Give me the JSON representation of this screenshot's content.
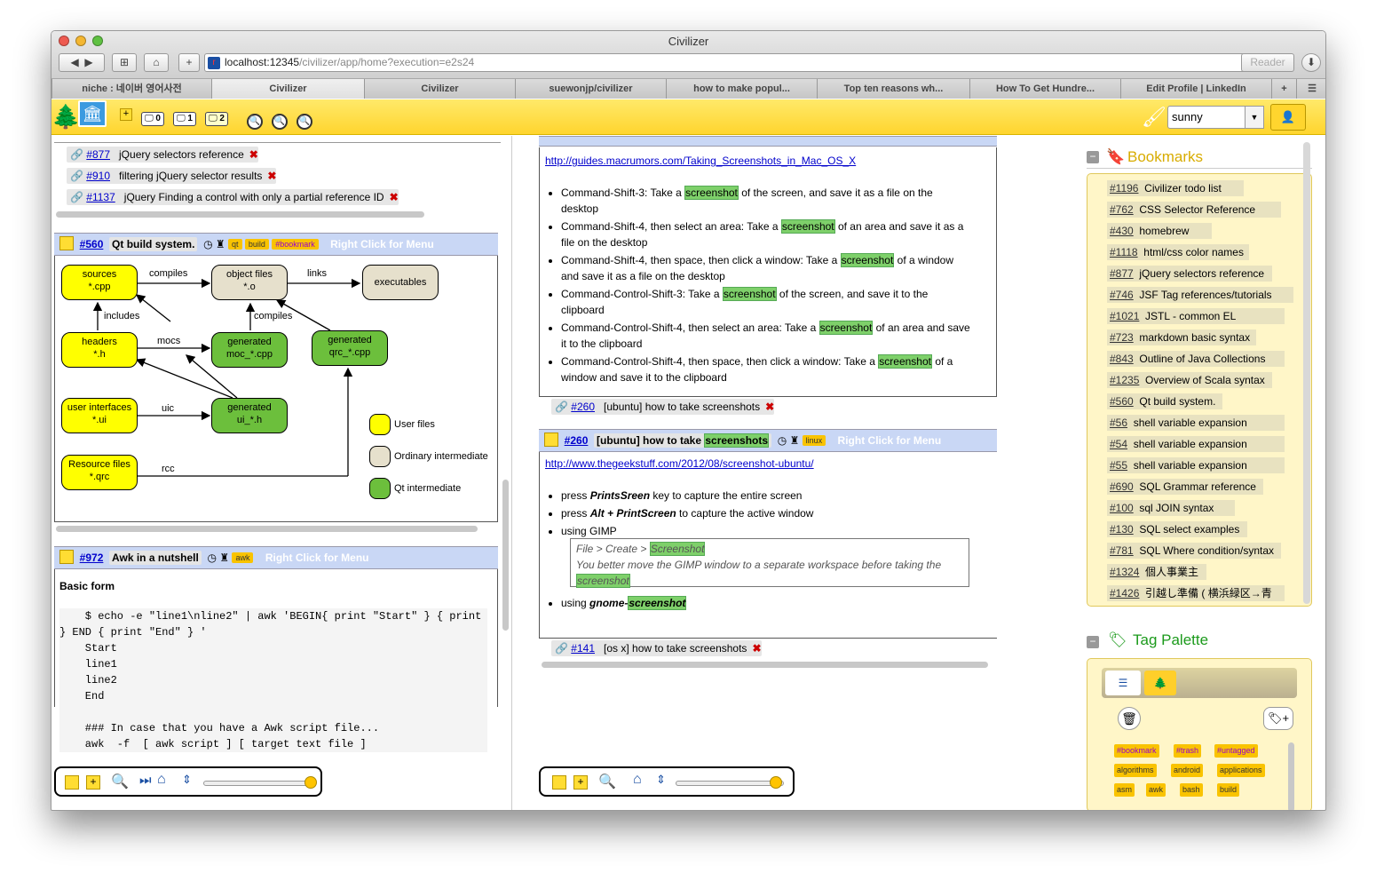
{
  "window": {
    "title": "Civilizer"
  },
  "nav": {
    "url_host": "localhost:12345",
    "url_path": "/civilizer/app/home?execution=e2s24",
    "reader_label": "Reader"
  },
  "tabs": [
    {
      "label": "niche : 네이버 영어사전"
    },
    {
      "label": "Civilizer"
    },
    {
      "label": "Civilizer"
    },
    {
      "label": "suewonjp/civilizer"
    },
    {
      "label": "how to make popul..."
    },
    {
      "label": "Top ten reasons wh..."
    },
    {
      "label": "How To Get Hundre..."
    },
    {
      "label": "Edit Profile | LinkedIn"
    }
  ],
  "appbar": {
    "monitors": [
      "0",
      "1",
      "2"
    ],
    "user": "sunny"
  },
  "left_panel": {
    "refs": [
      {
        "id": "#877",
        "title": "jQuery selectors reference"
      },
      {
        "id": "#910",
        "title": "filtering jQuery selector results"
      },
      {
        "id": "#1137",
        "title": "jQuery Finding a control with only a partial reference ID"
      }
    ],
    "fragment1": {
      "id": "#560",
      "title": "Qt build system.",
      "tags": [
        "qt",
        "build",
        "#bookmark"
      ],
      "menu_hint": "Right Click for Menu",
      "diagram": {
        "nodes": {
          "sources": "sources",
          "sources_ext": "*.cpp",
          "objects": "object files",
          "objects_ext": "*.o",
          "executables": "executables",
          "headers": "headers",
          "headers_ext": "*.h",
          "moc": "generated",
          "moc_ext": "moc_*.cpp",
          "qrc": "generated",
          "qrc_ext": "qrc_*.cpp",
          "ui_files": "user interfaces",
          "ui_files_ext": "*.ui",
          "ui_h": "generated",
          "ui_h_ext": "ui_*.h",
          "res": "Resource files",
          "res_ext": "*.qrc"
        },
        "edges": {
          "compiles1": "compiles",
          "links": "links",
          "includes": "includes",
          "compiles2": "compiles",
          "mocs": "mocs",
          "uic": "uic",
          "rcc": "rcc"
        },
        "legend": [
          "User files",
          "Ordinary intermediate",
          "Qt intermediate"
        ]
      }
    },
    "fragment2": {
      "id": "#972",
      "title": "Awk in a nutshell",
      "tags": [
        "awk"
      ],
      "menu_hint": "Right Click for Menu",
      "heading": "Basic form",
      "code": [
        "    $ echo -e \"line1\\nline2\" | awk 'BEGIN{ print \"Start\" } { print",
        "} END { print \"End\" } '",
        "    Start",
        "    line1",
        "    line2",
        "    End",
        "",
        "    ### In case that you have a Awk script file...",
        "    awk  -f  [ awk script ] [ target text file ]"
      ]
    }
  },
  "middle_panel": {
    "frag_top": {
      "link": "http://guides.macrumors.com/Taking_Screenshots_in_Mac_OS_X",
      "items": [
        {
          "pre": "Command-Shift-3: Take a ",
          "hl": "screenshot",
          "post": " of the screen, and save it as a file on the desktop"
        },
        {
          "pre": "Command-Shift-4, then select an area: Take a ",
          "hl": "screenshot",
          "post": " of an area and save it as a file on the desktop"
        },
        {
          "pre": "Command-Shift-4, then space, then click a window: Take a ",
          "hl": "screenshot",
          "post": " of a window and save it as a file on the desktop"
        },
        {
          "pre": "Command-Control-Shift-3: Take a ",
          "hl": "screenshot",
          "post": " of the screen, and save it to the clipboard"
        },
        {
          "pre": "Command-Control-Shift-4, then select an area: Take a ",
          "hl": "screenshot",
          "post": " of an area and save it to the clipboard"
        },
        {
          "pre": "Command-Control-Shift-4, then space, then click a window: Take a ",
          "hl": "screenshot",
          "post": " of a window and save it to the clipboard"
        }
      ]
    },
    "ref1": {
      "id": "#260",
      "title": "[ubuntu] how to take screenshots"
    },
    "frag2": {
      "id": "#260",
      "title_pre": "[ubuntu] how to take ",
      "title_hl": "screenshots",
      "tags": [
        "linux"
      ],
      "menu_hint": "Right Click for Menu",
      "link": "http://www.thegeekstuff.com/2012/08/screenshot-ubuntu/",
      "item1_pre": "press ",
      "item1_key": "PrintsSreen",
      "item1_post": " key to capture the entire screen",
      "item2_pre": "press ",
      "item2_key": "Alt + PrintScreen",
      "item2_post": " to capture the active window",
      "item3": "using GIMP",
      "quote_line1_pre": "File > Create > ",
      "quote_line1_hl": "Screenshot",
      "quote_line2": "You better move the GIMP window to a separate workspace before taking the",
      "quote_line3_hl": "screenshot",
      "item4_pre": "using ",
      "item4_bold": "gnome-",
      "item4_hl": "screenshot"
    },
    "ref2": {
      "id": "#141",
      "title": "[os x] how to take screenshots"
    }
  },
  "right_panel": {
    "bookmarks_title": "Bookmarks",
    "bookmarks": [
      {
        "id": "#1196",
        "title": "Civilizer todo list"
      },
      {
        "id": "#762",
        "title": "CSS Selector Reference"
      },
      {
        "id": "#430",
        "title": "homebrew"
      },
      {
        "id": "#1118",
        "title": "html/css color names"
      },
      {
        "id": "#877",
        "title": "jQuery selectors reference"
      },
      {
        "id": "#746",
        "title": "JSF Tag references/tutorials"
      },
      {
        "id": "#1021",
        "title": "JSTL - common EL"
      },
      {
        "id": "#723",
        "title": "markdown basic syntax"
      },
      {
        "id": "#843",
        "title": "Outline of Java Collections"
      },
      {
        "id": "#1235",
        "title": "Overview of Scala syntax"
      },
      {
        "id": "#560",
        "title": "Qt build system."
      },
      {
        "id": "#56",
        "title": "shell variable expansion"
      },
      {
        "id": "#54",
        "title": "shell variable expansion"
      },
      {
        "id": "#55",
        "title": "shell variable expansion"
      },
      {
        "id": "#690",
        "title": "SQL Grammar reference"
      },
      {
        "id": "#100",
        "title": "sql JOIN syntax"
      },
      {
        "id": "#130",
        "title": "SQL select examples"
      },
      {
        "id": "#781",
        "title": "SQL Where condition/syntax"
      },
      {
        "id": "#1324",
        "title": "個人事業主"
      },
      {
        "id": "#1426",
        "title": "引越し準備 ( 横浜緑区→青"
      }
    ],
    "palette_title": "Tag Palette",
    "palette_tags": [
      "#bookmark",
      "#trash",
      "#untagged",
      "algorithms",
      "android",
      "applications",
      "asm",
      "awk",
      "bash",
      "build"
    ]
  },
  "colors": {
    "accent": "#ffd52e",
    "highlight": "#7ed06a",
    "header_blue": "#c9d7f5"
  }
}
